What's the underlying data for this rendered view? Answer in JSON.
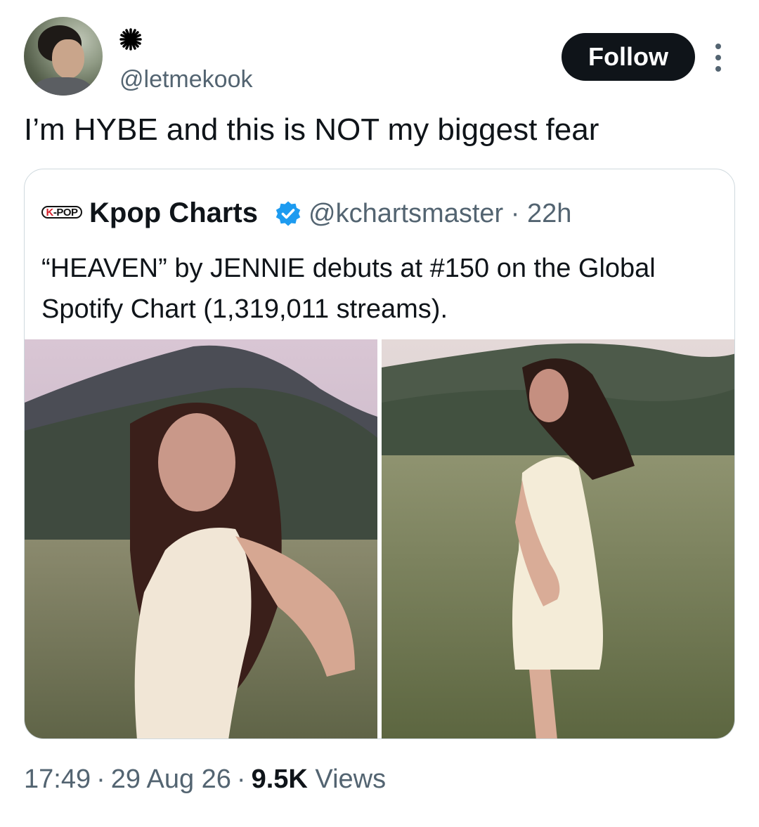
{
  "author": {
    "handle": "@letmekook",
    "display_name_icon": "sparkle-icon",
    "avatar": "avatar-photo",
    "follow_label": "Follow",
    "more_icon": "more-vertical-icon"
  },
  "tweet": {
    "text": "I’m HYBE and this is NOT my biggest fear"
  },
  "quote": {
    "logo_k": "K",
    "logo_rest": "-POP",
    "name": "Kpop Charts",
    "verified_icon": "verified-badge-icon",
    "handle_time": "@kchartsmaster · 22h",
    "text": "“HEAVEN” by JENNIE debuts at #150 on the Global Spotify Chart (1,319,011 streams).",
    "media": [
      {
        "description_icon": "photo-woman-field-closeup"
      },
      {
        "description_icon": "photo-woman-field-reaching"
      }
    ]
  },
  "meta": {
    "time": "17:49",
    "date": "29 Aug 26",
    "views_count": "9.5K",
    "views_label": "Views"
  },
  "colors": {
    "text": "#0f1419",
    "secondary": "#536471",
    "border": "#cfd9de",
    "verified": "#1d9bf0",
    "button": "#0f1419"
  }
}
